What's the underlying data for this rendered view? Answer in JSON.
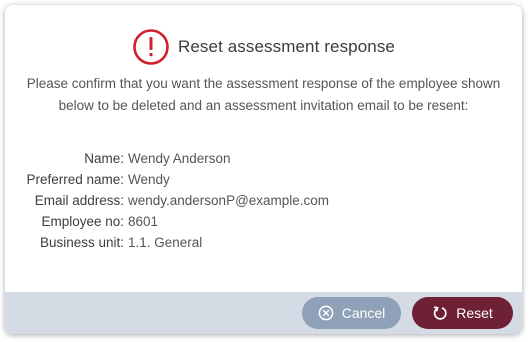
{
  "dialog": {
    "title": "Reset assessment response",
    "alert_icon": "exclamation-circle-icon",
    "message": "Please confirm that you want the assessment response of the employee shown below to be deleted and an assessment invitation email to be resent:",
    "details": [
      {
        "label": "Name:",
        "value": "Wendy Anderson"
      },
      {
        "label": "Preferred name:",
        "value": "Wendy"
      },
      {
        "label": "Email address:",
        "value": "wendy.andersonP@example.com"
      },
      {
        "label": "Employee no:",
        "value": "8601"
      },
      {
        "label": "Business unit:",
        "value": "1.1. General"
      }
    ]
  },
  "buttons": {
    "cancel": {
      "label": "Cancel",
      "icon": "cancel-circle-icon"
    },
    "reset": {
      "label": "Reset",
      "icon": "reset-arrow-icon"
    }
  },
  "colors": {
    "alert": "#d0202c",
    "footer": "#d5dbe4",
    "cancel_button": "#8ea1b8",
    "reset_button": "#6e2035"
  }
}
